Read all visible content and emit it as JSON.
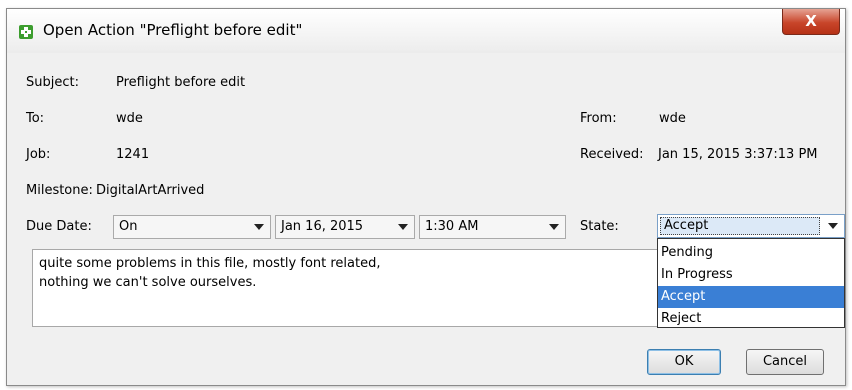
{
  "window": {
    "title": "Open Action \"Preflight before edit\"",
    "close_label": "X"
  },
  "fields": {
    "subject_label": "Subject:",
    "subject_value": "Preflight before edit",
    "to_label": "To:",
    "to_value": "wde",
    "from_label": "From:",
    "from_value": "wde",
    "job_label": "Job:",
    "job_value": "1241",
    "received_label": "Received:",
    "received_value": "Jan 15, 2015 3:37:13 PM",
    "milestone_label": "Milestone:",
    "milestone_value": "DigitalArtArrived",
    "due_label": "Due Date:",
    "due_mode": "On",
    "due_date": "Jan 16, 2015",
    "due_time": "1:30 AM",
    "state_label": "State:",
    "state_value": "Accept"
  },
  "state_options": [
    "Pending",
    "In Progress",
    "Accept",
    "Reject"
  ],
  "notes": "quite some problems in this file, mostly font related,\nnothing we can't solve ourselves.",
  "buttons": {
    "ok": "OK",
    "cancel": "Cancel"
  },
  "colors": {
    "selection": "#3a7fd5",
    "close_button": "#c8452a",
    "app_icon": "#3c9d2e"
  },
  "icons": {
    "app": "action-app-icon",
    "close": "close-icon",
    "dropdown": "chevron-down-icon"
  }
}
